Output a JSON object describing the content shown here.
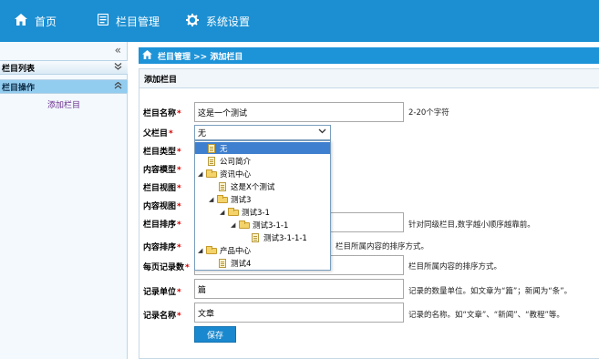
{
  "nav": {
    "items": [
      {
        "label": "首页",
        "icon": "home-icon"
      },
      {
        "label": "栏目管理",
        "icon": "list-icon"
      },
      {
        "label": "系统设置",
        "icon": "gear-icon"
      }
    ]
  },
  "sidebar": {
    "collapse_glyph": "«",
    "groups": [
      {
        "label": "栏目列表",
        "expanded": false
      },
      {
        "label": "栏目操作",
        "expanded": true
      }
    ],
    "links": [
      {
        "label": "添加栏目"
      }
    ]
  },
  "breadcrumb": {
    "path": "栏目管理 >> 添加栏目"
  },
  "form": {
    "title": "添加栏目",
    "name": {
      "label": "栏目名称",
      "value": "这是一个测试",
      "hint": "2-20个字符"
    },
    "parent": {
      "label": "父栏目",
      "value": "无"
    },
    "type": {
      "label": "栏目类型"
    },
    "content_model": {
      "label": "内容模型"
    },
    "column_view": {
      "label": "栏目视图"
    },
    "content_view": {
      "label": "内容视图"
    },
    "sort": {
      "label": "栏目排序",
      "hint": "针对同级栏目,数字越小顺序越靠前。"
    },
    "content_sort": {
      "label": "内容排序",
      "hint": "栏目所属内容的排序方式。"
    },
    "page_size": {
      "label": "每页记录数",
      "hint": "栏目所属内容的排序方式。"
    },
    "unit": {
      "label": "记录单位",
      "value": "篇",
      "hint": "记录的数量单位。如文章为“篇”；新闻为“条”。"
    },
    "record_name": {
      "label": "记录名称",
      "value": "文章",
      "hint": "记录的名称。如“文章”、“新闻”、“教程”等。"
    },
    "save_label": "保存"
  },
  "tree": {
    "nodes": [
      {
        "label": "无",
        "kind": "page",
        "selected": true
      },
      {
        "label": "公司简介",
        "kind": "page"
      },
      {
        "label": "资讯中心",
        "kind": "folder"
      },
      {
        "label": "这是X个测试",
        "kind": "page"
      },
      {
        "label": "测试3",
        "kind": "folder"
      },
      {
        "label": "测试3-1",
        "kind": "folder"
      },
      {
        "label": "测试3-1-1",
        "kind": "folder"
      },
      {
        "label": "测试3-1-1-1",
        "kind": "page"
      },
      {
        "label": "产品中心",
        "kind": "folder"
      },
      {
        "label": "测试4",
        "kind": "page"
      }
    ]
  },
  "colors": {
    "nav_bar": "#1b8fd2",
    "breadcrumb": "#1d93d8",
    "sidebar_active": "#92cdf0",
    "required": "#d20000",
    "tree_selected": "#3f7fcf",
    "save_button": "#1a88cf"
  }
}
